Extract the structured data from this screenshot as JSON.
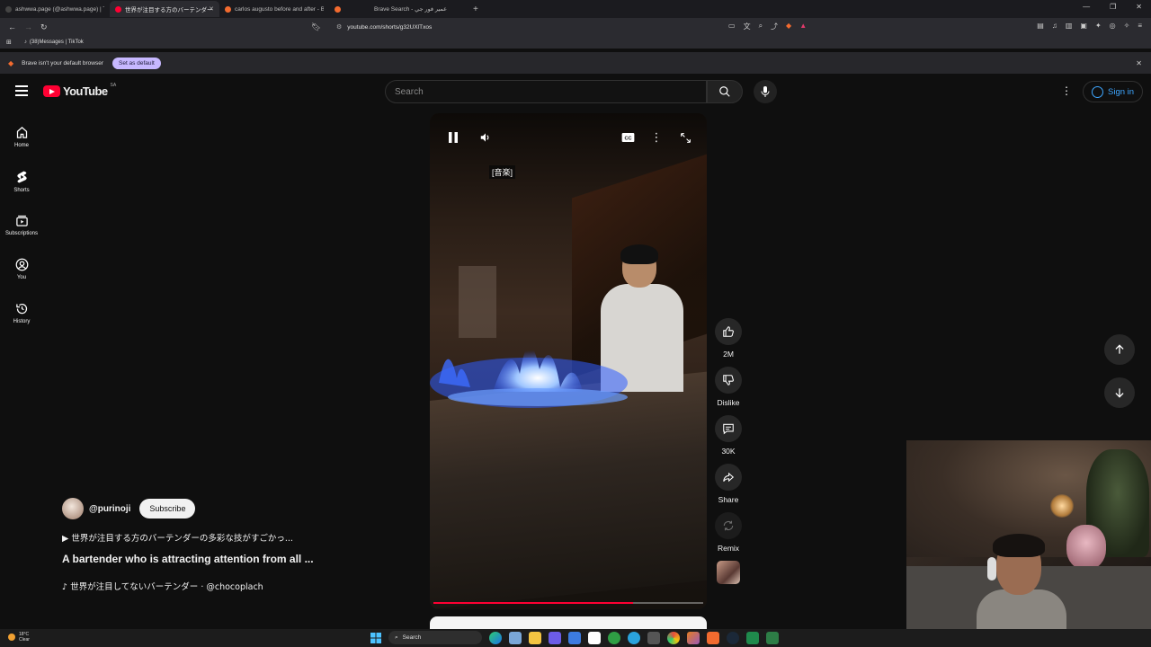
{
  "browser": {
    "tabs": [
      {
        "label": "ashwwa.page (@ashwwa.page) | TikTok",
        "color": "#222"
      },
      {
        "label": "世界が注目する方のバーテンダー",
        "color": "#ff0033",
        "active": true
      },
      {
        "label": "carlos augusto before and after - Br",
        "color": "#f36b2f"
      },
      {
        "label": "",
        "color": "#f36b2f"
      },
      {
        "label": "Brave Search - عمير فور جي",
        "color": "#f36b2f"
      }
    ],
    "new_tab": "+",
    "url": "youtube.com/shorts/g32UXlTxos",
    "bookmark": "(38)Messages | TikTok",
    "notice_text": "Brave isn't your default browser",
    "set_default": "Set as default"
  },
  "youtube": {
    "logo_text": "YouTube",
    "country_code": "SA",
    "search_placeholder": "Search",
    "sign_in": "Sign in",
    "sidebar": [
      {
        "label": "Home",
        "icon": "home-icon"
      },
      {
        "label": "Shorts",
        "icon": "shorts-icon"
      },
      {
        "label": "Subscriptions",
        "icon": "subscriptions-icon"
      },
      {
        "label": "You",
        "icon": "you-icon"
      },
      {
        "label": "History",
        "icon": "history-icon"
      }
    ]
  },
  "player": {
    "caption": "[音楽]",
    "progress": 0.74
  },
  "actions": {
    "like_count": "2M",
    "dislike": "Dislike",
    "comments_count": "30K",
    "share": "Share",
    "remix": "Remix"
  },
  "video": {
    "channel": "@purinoji",
    "subscribe": "Subscribe",
    "description": "▶ 世界が注目する方のバーテンダーの多彩な技がすごかっ...",
    "title": "A bartender who is attracting attention from all ...",
    "music": "♪ 世界が注目してないバーテンダー · @chocoplach"
  },
  "taskbar": {
    "temperature": "18°C",
    "weather": "Clear",
    "search": "Search"
  }
}
